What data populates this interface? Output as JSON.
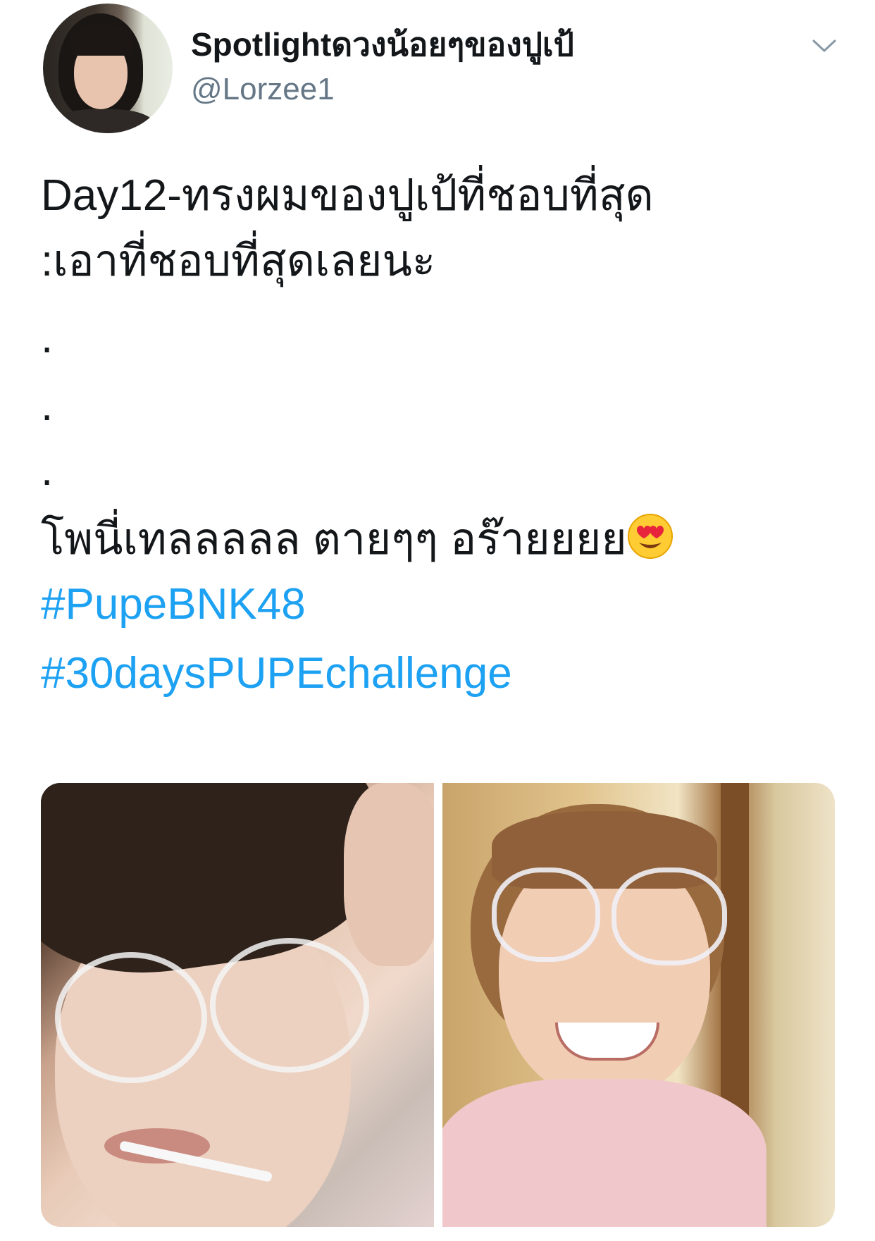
{
  "author": {
    "display_name": "Spotlightดวงน้อยๆของปูเป้",
    "handle": "@Lorzee1"
  },
  "icons": {
    "menu": "chevron-down-icon",
    "avatar": "profile-photo",
    "emoji": "heart-eyes-emoji"
  },
  "tweet": {
    "line1": "Day12-ทรงผมของปูเป้ที่ชอบที่สุด",
    "line2": ":เอาที่ชอบที่สุดเลยนะ",
    "dot1": ".",
    "dot2": ".",
    "dot3": ".",
    "line3": "โพนี่เทลลลลล ตายๆๆ อร๊ายยยย",
    "hashtags": [
      "#PupeBNK48",
      "#30daysPUPEchallenge"
    ]
  },
  "colors": {
    "text": "#14171a",
    "secondary": "#657786",
    "link": "#1da1f2"
  }
}
